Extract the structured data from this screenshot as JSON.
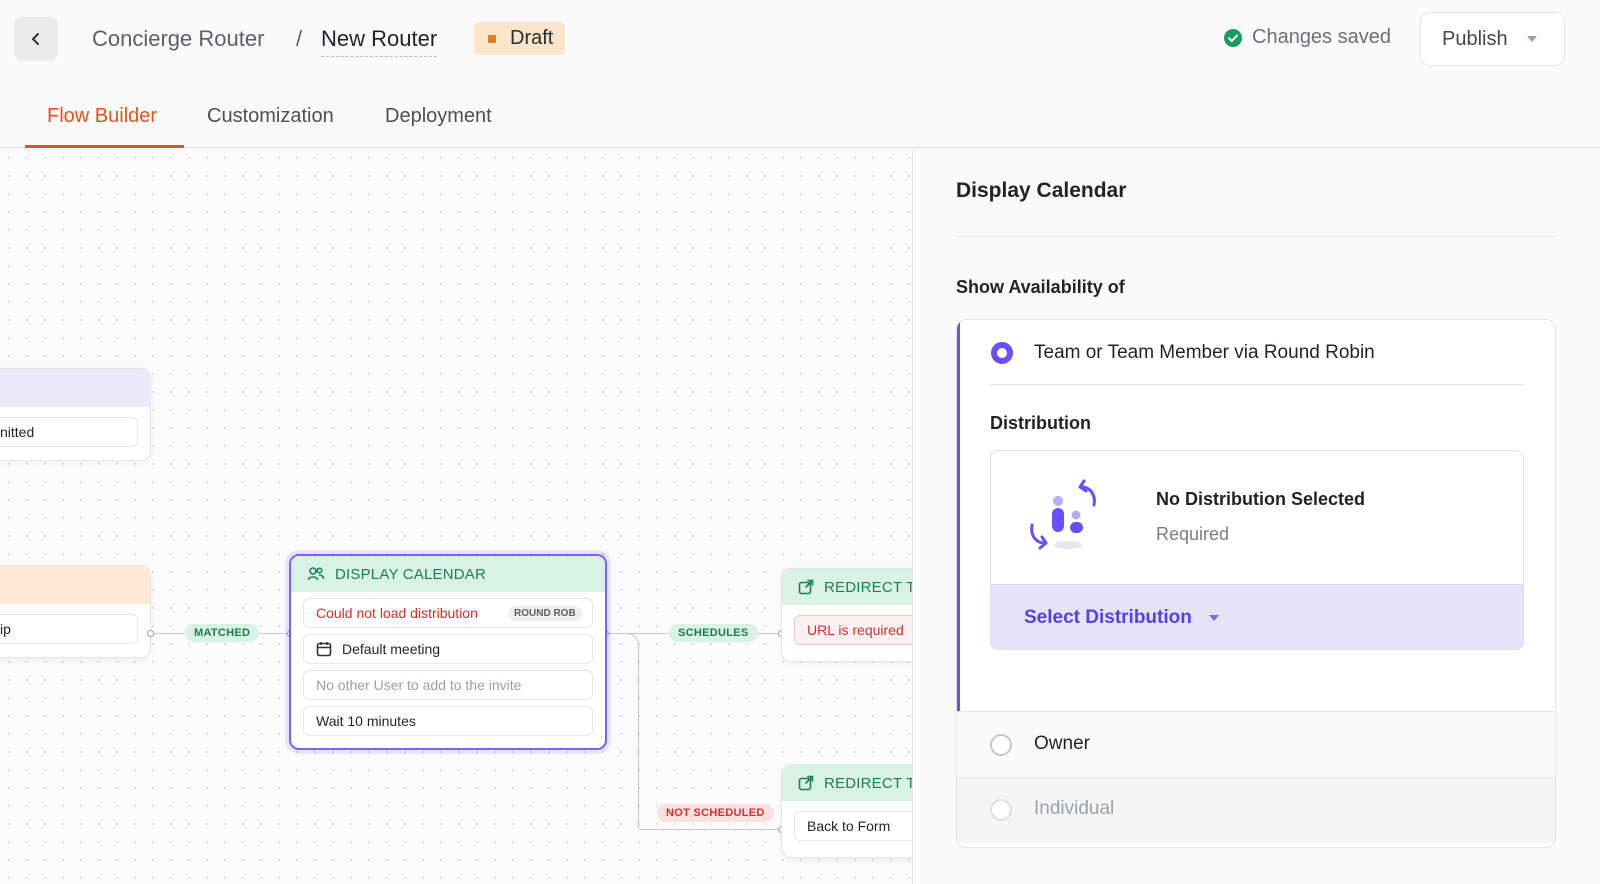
{
  "header": {
    "breadcrumb_parent": "Concierge Router",
    "breadcrumb_separator": "/",
    "breadcrumb_current": "New Router",
    "status_badge": "Draft",
    "save_status": "Changes saved",
    "publish_label": "Publish"
  },
  "tabs": [
    {
      "label": "Flow Builder",
      "active": true
    },
    {
      "label": "Customization",
      "active": false
    },
    {
      "label": "Deployment",
      "active": false
    }
  ],
  "canvas": {
    "node_left_top": {
      "row_text": "nitted",
      "head_color": "#ece9fb"
    },
    "node_left_bottom": {
      "row_text": "ip",
      "head_color": "#fde9d6"
    },
    "node_display_calendar": {
      "title": "DISPLAY CALENDAR",
      "error_text": "Could not load distribution",
      "tag": "ROUND ROB",
      "meeting": "Default meeting",
      "placeholder": "No other User to add to the invite",
      "wait": "Wait 10 minutes"
    },
    "node_redirect_top": {
      "title": "REDIRECT TO",
      "error_text": "URL is required"
    },
    "node_redirect_bottom": {
      "title": "REDIRECT TO",
      "row_text": "Back to Form"
    },
    "edge_labels": {
      "matched": "MATCHED",
      "schedules": "SCHEDULES",
      "not_scheduled": "NOT SCHEDULED"
    }
  },
  "panel": {
    "title": "Display Calendar",
    "section_label": "Show Availability of",
    "options": [
      {
        "label": "Team or Team Member via Round Robin",
        "selected": true
      },
      {
        "label": "Owner",
        "selected": false
      },
      {
        "label": "Individual",
        "selected": false,
        "disabled": true
      }
    ],
    "distribution": {
      "label": "Distribution",
      "empty_title": "No Distribution Selected",
      "empty_sub": "Required",
      "select_label": "Select Distribution"
    }
  },
  "colors": {
    "accent": "#e2541d",
    "purple": "#6b4eff",
    "success": "#1a9b63",
    "error": "#d32f2f"
  }
}
